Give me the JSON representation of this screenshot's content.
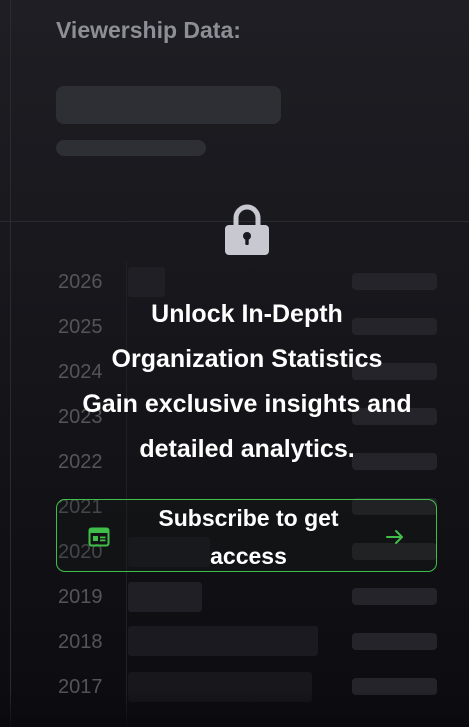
{
  "viewership": {
    "section_title": "Viewership Data:"
  },
  "chart": {
    "years": [
      "2026",
      "2025",
      "2024",
      "2023",
      "2022",
      "2021",
      "2020",
      "2019",
      "2018",
      "2017"
    ]
  },
  "paywall": {
    "icon": "lock-icon",
    "headline_line1": "Unlock In-Depth",
    "headline_line2": "Organization Statistics",
    "subline_line1": "Gain exclusive insights and",
    "subline_line2": "detailed analytics.",
    "cta_label": "Subscribe to get access",
    "cta_icon": "subscribe-card-icon",
    "cta_arrow_icon": "arrow-right-icon",
    "accent_color": "#3fbf4a",
    "lock_color": "#c8c8d0"
  }
}
